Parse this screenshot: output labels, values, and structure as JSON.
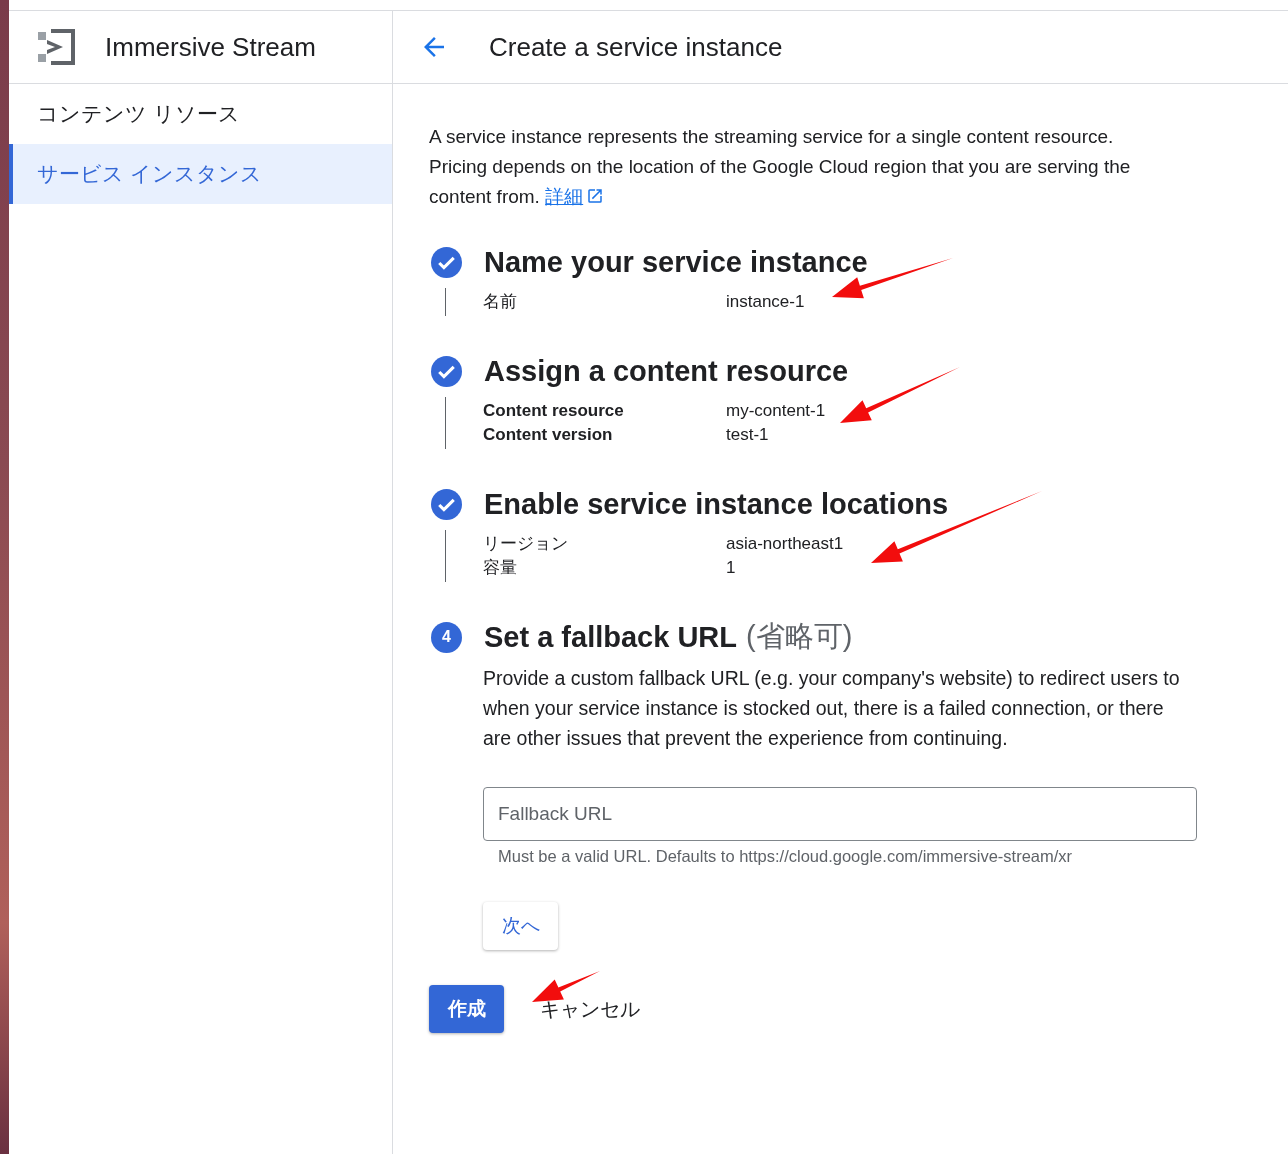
{
  "sidebar": {
    "title": "Immersive Stream",
    "items": [
      {
        "label": "コンテンツ リソース",
        "selected": false
      },
      {
        "label": "サービス インスタンス",
        "selected": true
      }
    ]
  },
  "header": {
    "title": "Create a service instance"
  },
  "intro": {
    "text": "A service instance represents the streaming service for a single content resource. Pricing depends on the location of the Google Cloud region that you are serving the content from.",
    "link": "詳細"
  },
  "steps": [
    {
      "kind": "done",
      "title": "Name your service instance",
      "fields": [
        {
          "label": "名前",
          "value": "instance-1",
          "bold": false
        }
      ]
    },
    {
      "kind": "done",
      "title": "Assign a content resource",
      "fields": [
        {
          "label": "Content resource",
          "value": "my-content-1",
          "bold": true
        },
        {
          "label": "Content version",
          "value": "test-1",
          "bold": true
        }
      ]
    },
    {
      "kind": "done",
      "title": "Enable service instance locations",
      "fields": [
        {
          "label": "リージョン",
          "value": "asia-northeast1",
          "bold": false
        },
        {
          "label": "容量",
          "value": "1",
          "bold": false
        }
      ]
    },
    {
      "kind": "active",
      "number": "4",
      "title": "Set a fallback URL",
      "suffix": "(省略可)",
      "description": "Provide a custom fallback URL (e.g. your company's website) to redirect users to when your service instance is stocked out, there is a failed connection, or there are other issues that prevent the experience from continuing.",
      "input": {
        "placeholder": "Fallback URL"
      },
      "helper": "Must be a valid URL. Defaults to https://cloud.google.com/immersive-stream/xr",
      "next_button": "次へ"
    }
  ],
  "footer": {
    "create_button": "作成",
    "cancel_button": "キャンセル"
  }
}
